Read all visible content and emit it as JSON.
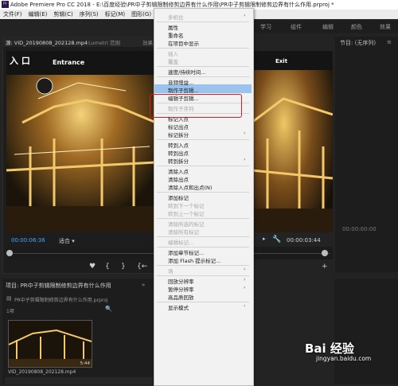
{
  "title_bar": {
    "app_logo": "Pr",
    "title": "Adobe Premiere Pro CC 2018 - E:\\百度经验\\PR中子剪辑限制修剪边界有什么作用\\PR中子剪辑限制修剪边界有什么作用.prproj *"
  },
  "menubar": [
    "文件(F)",
    "编辑(E)",
    "剪辑(C)",
    "序列(S)",
    "标记(M)",
    "图形(G)",
    "窗"
  ],
  "workspace_tabs": [
    "学习",
    "组件",
    "编辑",
    "颜色",
    "效果"
  ],
  "source_panel": {
    "tab_source": "源: VID_20190808_202128.mp4",
    "tab_lumetri": "Lumetri 范围",
    "tab_effects": "效果",
    "video_sign_left": "入 口",
    "video_sign_entrance": "Entrance",
    "timecode": "00:00:06:36",
    "fit_label": "适合"
  },
  "right_video": {
    "sign_exit": "Exit",
    "timecode": "00:00:03:44"
  },
  "program_panel": {
    "title": "节目: (无序列)",
    "timecode": "00:00:00:00"
  },
  "project_panel": {
    "title": "项目: PR中子剪辑限制修剪边界有什么作用",
    "path": "PR中子剪辑限制修剪边界有什么作用.prproj",
    "count": "1项",
    "clip_name": "VID_20190808_202128.mp4",
    "clip_duration": "5:44"
  },
  "context_menu": {
    "items": [
      {
        "label": "多机位",
        "enabled": false,
        "submenu": true
      },
      {
        "sep": true
      },
      {
        "label": "属性",
        "enabled": true
      },
      {
        "label": "重命名",
        "enabled": true
      },
      {
        "label": "在项目中显示",
        "enabled": true
      },
      {
        "sep": true
      },
      {
        "label": "插入",
        "enabled": false
      },
      {
        "label": "覆盖",
        "enabled": false
      },
      {
        "sep": true
      },
      {
        "label": "速度/持续时间...",
        "enabled": true
      },
      {
        "sep": true
      },
      {
        "label": "音频增益...",
        "enabled": true
      },
      {
        "label": "制作子剪辑...",
        "enabled": true,
        "highlighted": true
      },
      {
        "label": "编辑子剪辑...",
        "enabled": true
      },
      {
        "sep": true
      },
      {
        "label": "制作子序列",
        "enabled": false
      },
      {
        "sep": true
      },
      {
        "label": "标记入点",
        "enabled": true
      },
      {
        "label": "标记出点",
        "enabled": true
      },
      {
        "label": "标记拆分",
        "enabled": true,
        "submenu": true
      },
      {
        "sep": true
      },
      {
        "label": "转到入点",
        "enabled": true
      },
      {
        "label": "转到出点",
        "enabled": true
      },
      {
        "label": "转到拆分",
        "enabled": true,
        "submenu": true
      },
      {
        "sep": true
      },
      {
        "label": "清除入点",
        "enabled": true
      },
      {
        "label": "清除出点",
        "enabled": true
      },
      {
        "label": "清除入点和出点(N)",
        "enabled": true
      },
      {
        "sep": true
      },
      {
        "label": "添加标记",
        "enabled": true
      },
      {
        "label": "转到下一个标记",
        "enabled": false
      },
      {
        "label": "转到上一个标记",
        "enabled": false
      },
      {
        "sep": true
      },
      {
        "label": "清除所选的标记",
        "enabled": false
      },
      {
        "label": "清除所有标记",
        "enabled": false
      },
      {
        "sep": true
      },
      {
        "label": "编辑标记...",
        "enabled": false
      },
      {
        "sep": true
      },
      {
        "label": "添加章节标记...",
        "enabled": true
      },
      {
        "label": "添加 Flash 提示标记...",
        "enabled": true
      },
      {
        "sep": true
      },
      {
        "label": "场",
        "enabled": false,
        "submenu": true
      },
      {
        "sep": true
      },
      {
        "label": "回放分辨率",
        "enabled": true,
        "submenu": true
      },
      {
        "label": "暂停分辨率",
        "enabled": true,
        "submenu": true
      },
      {
        "label": "高品质回放",
        "enabled": true
      },
      {
        "sep": true
      },
      {
        "label": "显示模式",
        "enabled": true,
        "submenu": true
      }
    ]
  },
  "watermark": {
    "brand": "Bai 经验",
    "url": "jingyan.baidu.com"
  },
  "colors": {
    "timecode_blue": "#4aa3ff",
    "highlight": "#9ac4ee",
    "annotation_red": "#e0191e"
  }
}
